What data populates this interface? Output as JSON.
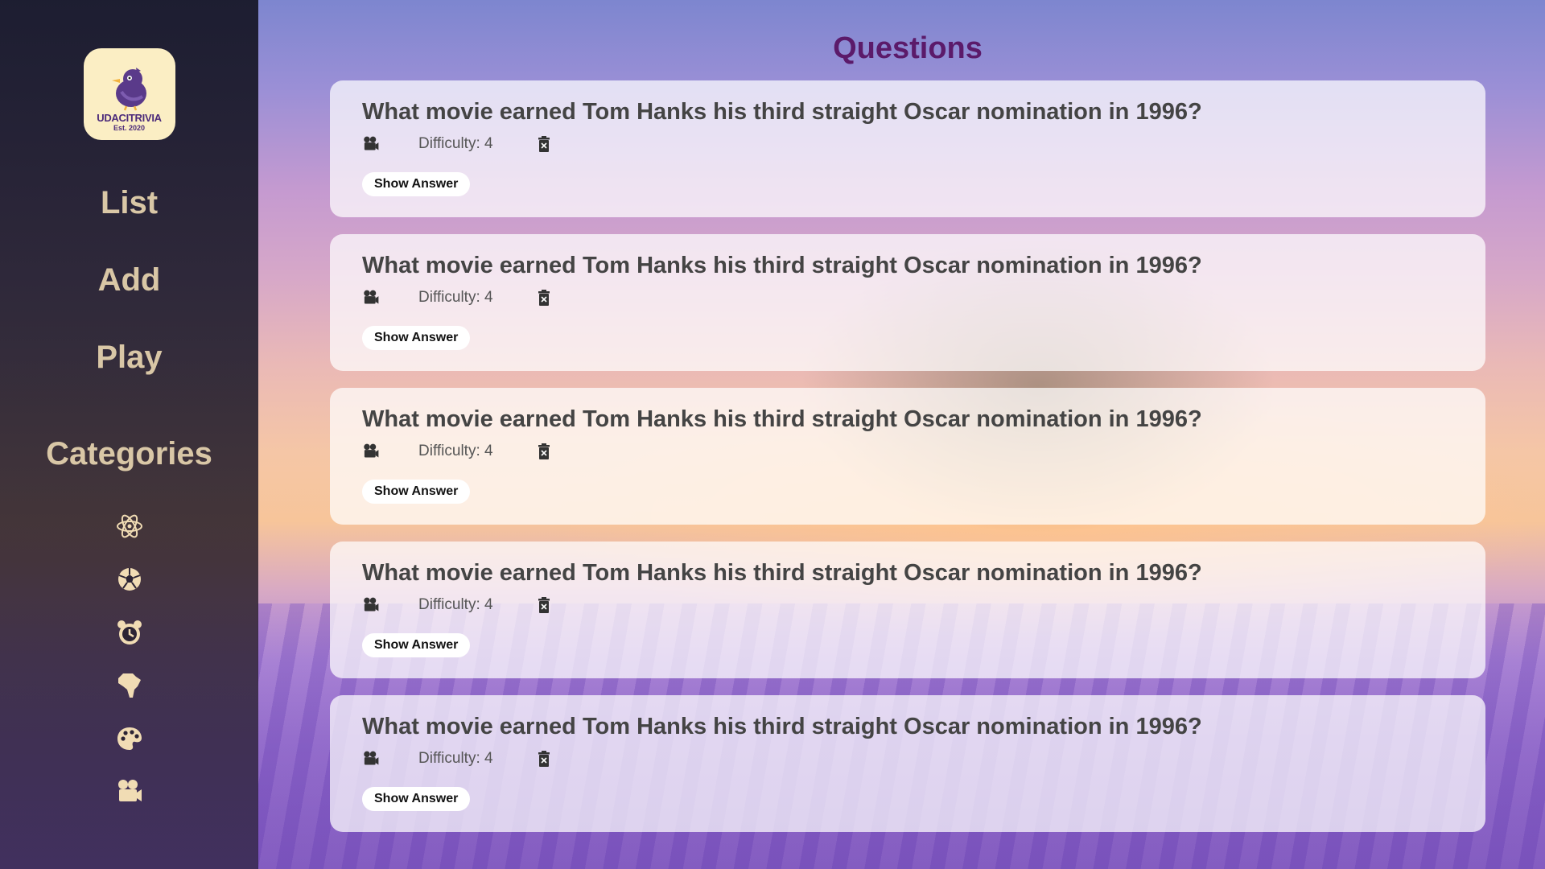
{
  "logo": {
    "name": "UDACITRIVIA",
    "est": "Est. 2020"
  },
  "nav": {
    "list": "List",
    "add": "Add",
    "play": "Play"
  },
  "sidebar": {
    "categories_title": "Categories",
    "category_icons": [
      "science-icon",
      "sports-icon",
      "history-icon",
      "geography-icon",
      "art-icon",
      "entertainment-icon"
    ]
  },
  "main": {
    "title": "Questions"
  },
  "questions": [
    {
      "text": "What movie earned Tom Hanks his third straight Oscar nomination in 1996?",
      "difficulty": "Difficulty: 4",
      "category_icon": "entertainment-icon",
      "button": "Show Answer"
    },
    {
      "text": "What movie earned Tom Hanks his third straight Oscar nomination in 1996?",
      "difficulty": "Difficulty: 4",
      "category_icon": "entertainment-icon",
      "button": "Show Answer"
    },
    {
      "text": "What movie earned Tom Hanks his third straight Oscar nomination in 1996?",
      "difficulty": "Difficulty: 4",
      "category_icon": "entertainment-icon",
      "button": "Show Answer"
    },
    {
      "text": "What movie earned Tom Hanks his third straight Oscar nomination in 1996?",
      "difficulty": "Difficulty: 4",
      "category_icon": "entertainment-icon",
      "button": "Show Answer"
    },
    {
      "text": "What movie earned Tom Hanks his third straight Oscar nomination in 1996?",
      "difficulty": "Difficulty: 4",
      "category_icon": "entertainment-icon",
      "button": "Show Answer"
    }
  ],
  "colors": {
    "sidebar_text": "#d9c7a6",
    "title": "#5b1a6a",
    "logo_bg": "#fbeec4"
  }
}
